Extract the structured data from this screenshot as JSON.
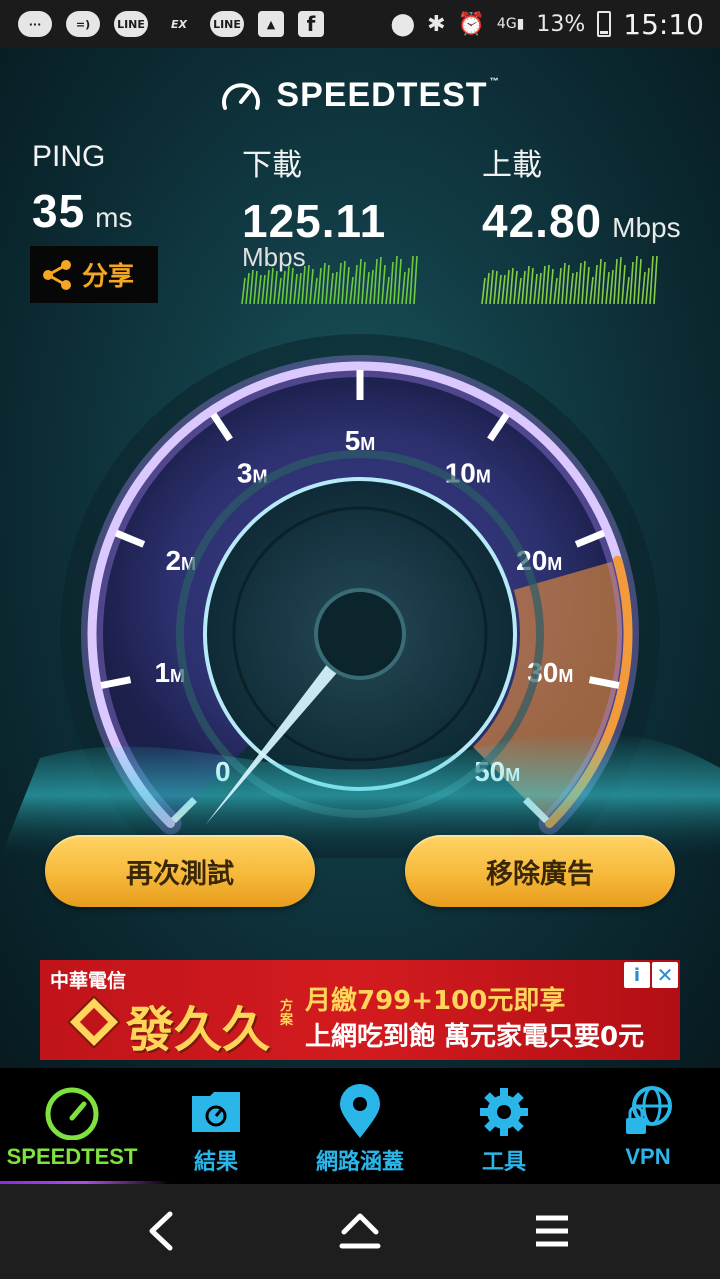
{
  "status_bar": {
    "left_icons": [
      "sms-icon",
      "chat-icon",
      "line-icon",
      "ex-icon",
      "line-icon",
      "image-icon",
      "facebook-icon"
    ],
    "line_label": "LINE",
    "ex_label": "EX",
    "network": "4G",
    "battery": "13%",
    "time": "15:10"
  },
  "app": {
    "brand": "SPEEDTEST",
    "brand_tm": "™",
    "ping": {
      "label": "PING",
      "value": "35",
      "unit": "ms"
    },
    "download": {
      "label": "下載",
      "value": "125.11",
      "unit": "Mbps"
    },
    "upload": {
      "label": "上載",
      "value": "42.80",
      "unit": "Mbps"
    },
    "share_label": "分享",
    "gauge": {
      "scale_labels": [
        {
          "num": "0",
          "unit": ""
        },
        {
          "num": "1",
          "unit": "M"
        },
        {
          "num": "2",
          "unit": "M"
        },
        {
          "num": "3",
          "unit": "M"
        },
        {
          "num": "5",
          "unit": "M"
        },
        {
          "num": "10",
          "unit": "M"
        },
        {
          "num": "20",
          "unit": "M"
        },
        {
          "num": "30",
          "unit": "M"
        },
        {
          "num": "50",
          "unit": "M"
        }
      ],
      "needle_value": "0",
      "ring_color": "#c7a6ff",
      "accent_color": "#f39a3d"
    },
    "buttons": {
      "retest": "再次測試",
      "remove_ads": "移除廣告"
    },
    "ad": {
      "brand": "中華電信",
      "headline": "發久久",
      "plan": "方案",
      "line1": "月繳799+100元即享",
      "line2": "上網吃到飽 萬元家電只要0元",
      "info": "i",
      "close": "✕"
    }
  },
  "app_nav": {
    "items": [
      {
        "label": "SPEEDTEST",
        "icon": "gauge-icon"
      },
      {
        "label": "結果",
        "icon": "results-folder-icon"
      },
      {
        "label": "網路涵蓋",
        "icon": "map-pin-icon"
      },
      {
        "label": "工具",
        "icon": "gear-icon"
      },
      {
        "label": "VPN",
        "icon": "vpn-lock-icon"
      }
    ],
    "active_color": "#7ee23f",
    "color": "#2bb6ea"
  },
  "system_nav": {
    "icons": [
      "back-icon",
      "home-icon",
      "menu-icon"
    ]
  }
}
